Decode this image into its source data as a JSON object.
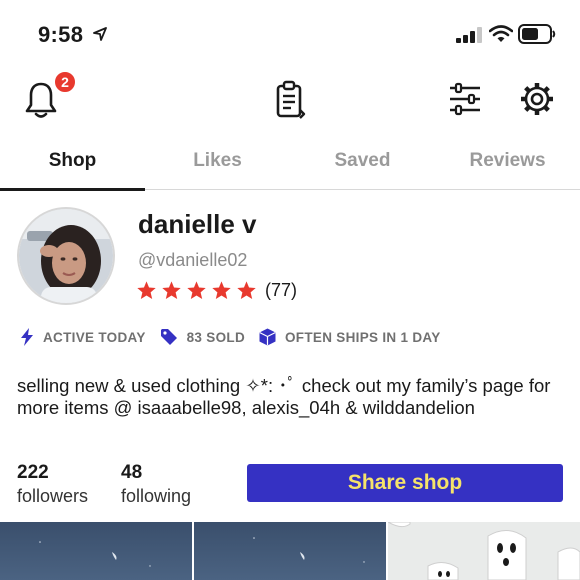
{
  "status": {
    "time": "9:58"
  },
  "notifications": {
    "badge_count": "2"
  },
  "tabs": [
    {
      "label": "Shop",
      "active": true
    },
    {
      "label": "Likes",
      "active": false
    },
    {
      "label": "Saved",
      "active": false
    },
    {
      "label": "Reviews",
      "active": false
    }
  ],
  "profile": {
    "name": "danielle v",
    "handle": "@vdanielle02",
    "rating_stars": 5,
    "rating_count": "(77)",
    "star_color": "#e8392e"
  },
  "info": {
    "active": "ACTIVE TODAY",
    "sold": "83 SOLD",
    "ships": "OFTEN SHIPS IN 1 DAY",
    "icon_color": "#3531c3"
  },
  "bio": "selling new & used clothing ✧*: ･ﾟ check out my family’s page for more items @ isaaabelle98, alexis_04h & wilddandelion",
  "stats": {
    "followers_count": "222",
    "followers_label": "followers",
    "following_count": "48",
    "following_label": "following"
  },
  "share_button": {
    "label": "Share shop",
    "bg": "#3531c3",
    "text_color": "#f5e36a"
  },
  "icons": {
    "bell": "bell-icon",
    "clipboard": "clipboard-icon",
    "filters": "sliders-icon",
    "settings": "gear-icon"
  }
}
